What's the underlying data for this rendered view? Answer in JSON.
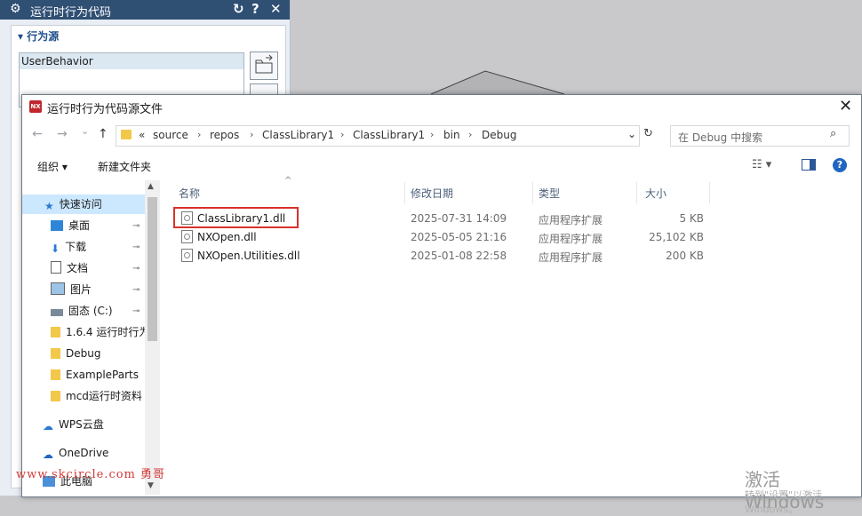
{
  "nx_panel": {
    "title": "运行时行为代码",
    "reset_glyph": "↻",
    "help_glyph": "?",
    "close_glyph": "✕",
    "group_title": "行为源",
    "list_item": "UserBehavior"
  },
  "dialog": {
    "title": "运行时行为代码源文件",
    "app_icon_text": "NX",
    "close_glyph": "✕",
    "nav": {
      "back": "←",
      "forward": "→",
      "recent": "⌄",
      "up": "↑"
    },
    "address": {
      "overflow": "«",
      "crumbs": [
        "source",
        "repos",
        "ClassLibrary1",
        "ClassLibrary1",
        "bin",
        "Debug"
      ],
      "separator": "›",
      "dropdown": "⌄",
      "refresh": "↻"
    },
    "search_placeholder": "在 Debug 中搜索",
    "search_glyph": "⌕",
    "toolbar": {
      "organize": "组织 ▾",
      "new_folder": "新建文件夹",
      "view": "☷ ▾",
      "help": "?"
    },
    "nav_pane": [
      {
        "label": "快速访问",
        "icon": "star-icon"
      },
      {
        "label": "桌面",
        "icon": "desktop-icon",
        "pinned": true
      },
      {
        "label": "下载",
        "icon": "download-icon",
        "pinned": true
      },
      {
        "label": "文档",
        "icon": "document-icon",
        "pinned": true
      },
      {
        "label": "图片",
        "icon": "picture-icon",
        "pinned": true
      },
      {
        "label": "固态 (C:)",
        "icon": "drive-icon",
        "pinned": true
      },
      {
        "label": "1.6.4 运行时行为",
        "icon": "folder-icon"
      },
      {
        "label": "Debug",
        "icon": "folder-icon"
      },
      {
        "label": "ExampleParts",
        "icon": "folder-icon"
      },
      {
        "label": "mcd运行时资料",
        "icon": "folder-icon"
      },
      {
        "label": "WPS云盘",
        "icon": "cloud-icon"
      },
      {
        "label": "OneDrive",
        "icon": "onedrive-icon"
      },
      {
        "label": "此电脑",
        "icon": "computer-icon"
      }
    ],
    "pin_glyph": "📌",
    "columns": {
      "name": "名称",
      "modified": "修改日期",
      "type": "类型",
      "size": "大小"
    },
    "sort_glyph": "^",
    "files": [
      {
        "name": "ClassLibrary1.dll",
        "modified": "2025-07-31 14:09",
        "type": "应用程序扩展",
        "size": "5 KB"
      },
      {
        "name": "NXOpen.dll",
        "modified": "2025-05-05 21:16",
        "type": "应用程序扩展",
        "size": "25,102 KB"
      },
      {
        "name": "NXOpen.Utilities.dll",
        "modified": "2025-01-08 22:58",
        "type": "应用程序扩展",
        "size": "200 KB"
      }
    ]
  },
  "overlay": {
    "watermark": "www.skcircle.com 勇哥",
    "activate": "激活 Windows",
    "activate_sub": "转到\"设置\"以激活 Windows。"
  },
  "colors": {
    "nx_titlebar": "#2f4f73",
    "highlight": "#d9302c",
    "accent": "#1f66c1"
  }
}
